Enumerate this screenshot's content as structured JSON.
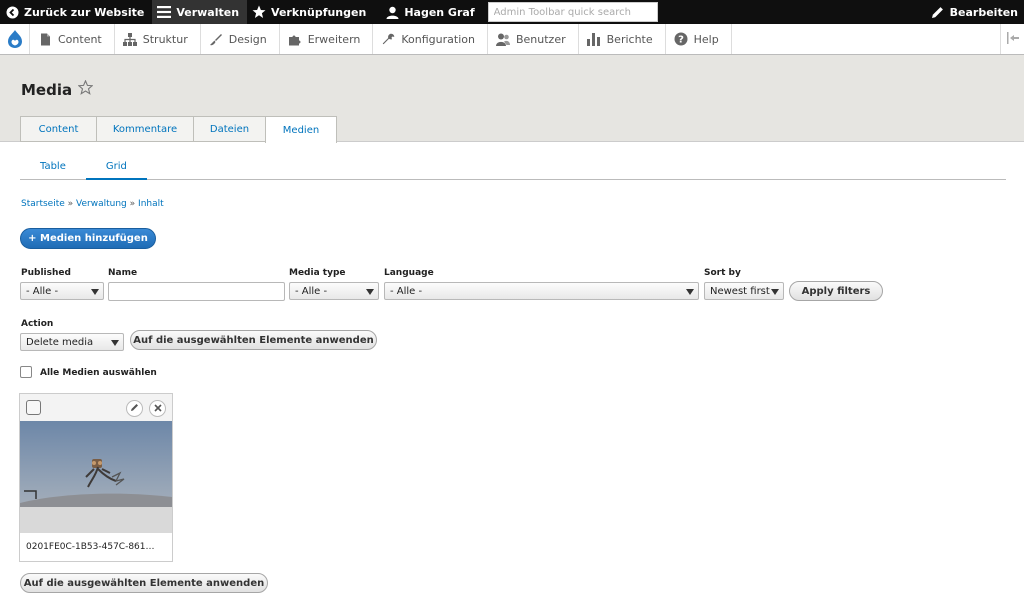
{
  "toolbar": {
    "back_label": "Zurück zur Website",
    "manage_label": "Verwalten",
    "shortcuts_label": "Verknüpfungen",
    "user_label": "Hagen Graf",
    "search_placeholder": "Admin Toolbar quick search",
    "edit_label": "Bearbeiten"
  },
  "tray": {
    "items": [
      {
        "label": "Content",
        "icon": "file-icon"
      },
      {
        "label": "Struktur",
        "icon": "sitemap-icon"
      },
      {
        "label": "Design",
        "icon": "paintbrush-icon"
      },
      {
        "label": "Erweitern",
        "icon": "puzzle-icon"
      },
      {
        "label": "Konfiguration",
        "icon": "wrench-icon"
      },
      {
        "label": "Benutzer",
        "icon": "people-icon"
      },
      {
        "label": "Berichte",
        "icon": "bar-chart-icon"
      },
      {
        "label": "Help",
        "icon": "help-icon"
      }
    ]
  },
  "page": {
    "title": "Media",
    "tabs": [
      {
        "label": "Content"
      },
      {
        "label": "Kommentare"
      },
      {
        "label": "Dateien"
      },
      {
        "label": "Medien",
        "active": true
      }
    ],
    "subtabs": [
      {
        "label": "Table"
      },
      {
        "label": "Grid",
        "active": true
      }
    ],
    "breadcrumb": [
      "Startseite",
      "Verwaltung",
      "Inhalt"
    ],
    "breadcrumb_sep": "»",
    "add_button": "+ Medien hinzufügen"
  },
  "filters": {
    "published_label": "Published",
    "published_value": "- Alle -",
    "name_label": "Name",
    "name_value": "",
    "media_type_label": "Media type",
    "media_type_value": "- Alle -",
    "language_label": "Language",
    "language_value": "- Alle -",
    "sort_label": "Sort by",
    "sort_value": "Newest first",
    "apply_button": "Apply filters"
  },
  "bulk": {
    "action_label": "Action",
    "action_value": "Delete media",
    "apply_button": "Auf die ausgewählten Elemente anwenden",
    "select_all_label": "Alle Medien auswählen",
    "bottom_apply_button": "Auf die ausgewählten Elemente anwenden"
  },
  "media": [
    {
      "name": "0201FE0C-1B53-457C-861…"
    }
  ],
  "colors": {
    "toolbar_bg": "#0f0f0f",
    "link": "#0074bd",
    "primary": "#2a7cc7",
    "header_bg": "#e6e5e1"
  }
}
